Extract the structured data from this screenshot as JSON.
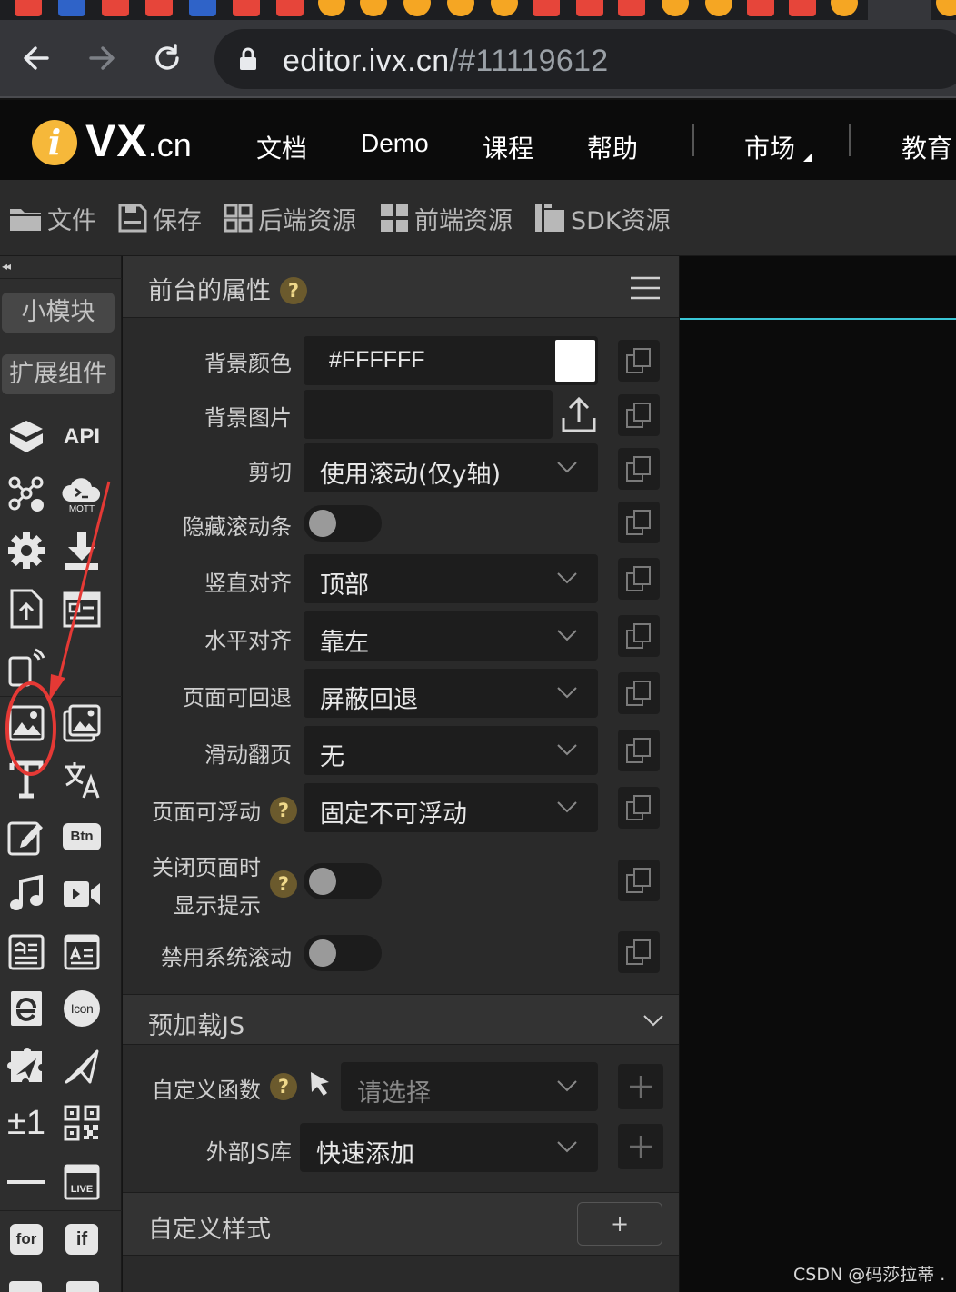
{
  "browser": {
    "url_host": "editor.ivx.cn",
    "url_path": "/#11119612"
  },
  "header": {
    "logo_badge": "i",
    "logo_main": "VX",
    "logo_suffix": ".cn",
    "nav": [
      "文档",
      "Demo",
      "课程",
      "帮助",
      "市场",
      "教育"
    ]
  },
  "toolbar": {
    "items": [
      "文件",
      "保存",
      "后端资源",
      "前端资源",
      "SDK资源"
    ]
  },
  "left_panel": {
    "collapse": "◂◂",
    "module_button": "小模块",
    "extension_button": "扩展组件",
    "api_label": "API",
    "mqtt_label": "MQTT",
    "btn_label": "Btn",
    "icon_label": "Icon",
    "live_label": "LIVE",
    "pm_label": "±1",
    "for_label": "for",
    "if_label": "if"
  },
  "props": {
    "title": "前台的属性",
    "help": "?",
    "rows": [
      {
        "label": "背景颜色",
        "value": "#FFFFFF"
      },
      {
        "label": "背景图片",
        "value": ""
      },
      {
        "label": "剪切",
        "value": "使用滚动(仅y轴)"
      },
      {
        "label": "隐藏滚动条",
        "value": ""
      },
      {
        "label": "竖直对齐",
        "value": "顶部"
      },
      {
        "label": "水平对齐",
        "value": "靠左"
      },
      {
        "label": "页面可回退",
        "value": "屏蔽回退"
      },
      {
        "label": "滑动翻页",
        "value": "无"
      },
      {
        "label": "页面可浮动",
        "value": "固定不可浮动"
      },
      {
        "label": "关闭页面时",
        "label2": "显示提示",
        "value": ""
      },
      {
        "label": "禁用系统滚动",
        "value": ""
      }
    ],
    "preload_section": "预加载JS",
    "custom_func_label": "自定义函数",
    "custom_func_placeholder": "请选择",
    "external_js_label": "外部JS库",
    "external_js_value": "快速添加",
    "custom_style_section": "自定义样式",
    "add_style_button": "+"
  },
  "colors": {
    "background_swatch": "#FFFFFF",
    "accent_line": "#39C6D6",
    "annotation": "#E53935"
  },
  "watermark": "CSDN @码莎拉蒂 ."
}
